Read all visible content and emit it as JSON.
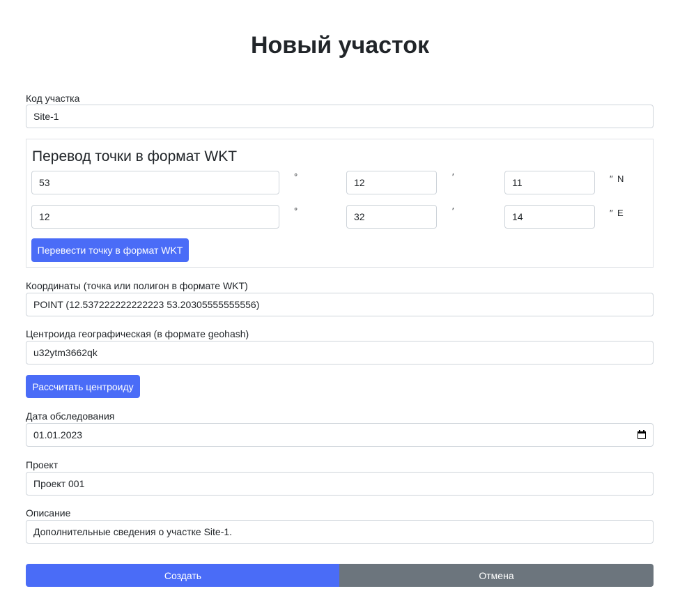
{
  "page": {
    "title": "Новый участок"
  },
  "site_code": {
    "label": "Код участка",
    "value": "Site-1"
  },
  "wkt_converter": {
    "title": "Перевод точки в формат WKT",
    "lat": {
      "deg": "53",
      "min": "12",
      "sec": "11",
      "hemisphere": "N"
    },
    "lon": {
      "deg": "12",
      "min": "32",
      "sec": "14",
      "hemisphere": "E"
    },
    "deg_symbol": "°",
    "min_symbol": "′",
    "sec_symbol": "″",
    "convert_button": "Перевести точку в формат WKT"
  },
  "coordinates": {
    "label": "Координаты (точка или полигон в формате WKT)",
    "value": "POINT (12.537222222222223 53.20305555555556)"
  },
  "centroid": {
    "label": "Центроида географическая (в формате geohash)",
    "value": "u32ytm3662qk",
    "button": "Рассчитать центроиду"
  },
  "survey_date": {
    "label": "Дата обследования",
    "value": "01.01.2023",
    "icon": "calendar-icon"
  },
  "project": {
    "label": "Проект",
    "value": "Проект 001"
  },
  "description": {
    "label": "Описание",
    "value": "Дополнительные сведения о участке Site-1."
  },
  "actions": {
    "create": "Создать",
    "cancel": "Отмена"
  },
  "colors": {
    "primary": "#4a6cf7",
    "secondary": "#6c757d",
    "border": "#ced4da"
  }
}
